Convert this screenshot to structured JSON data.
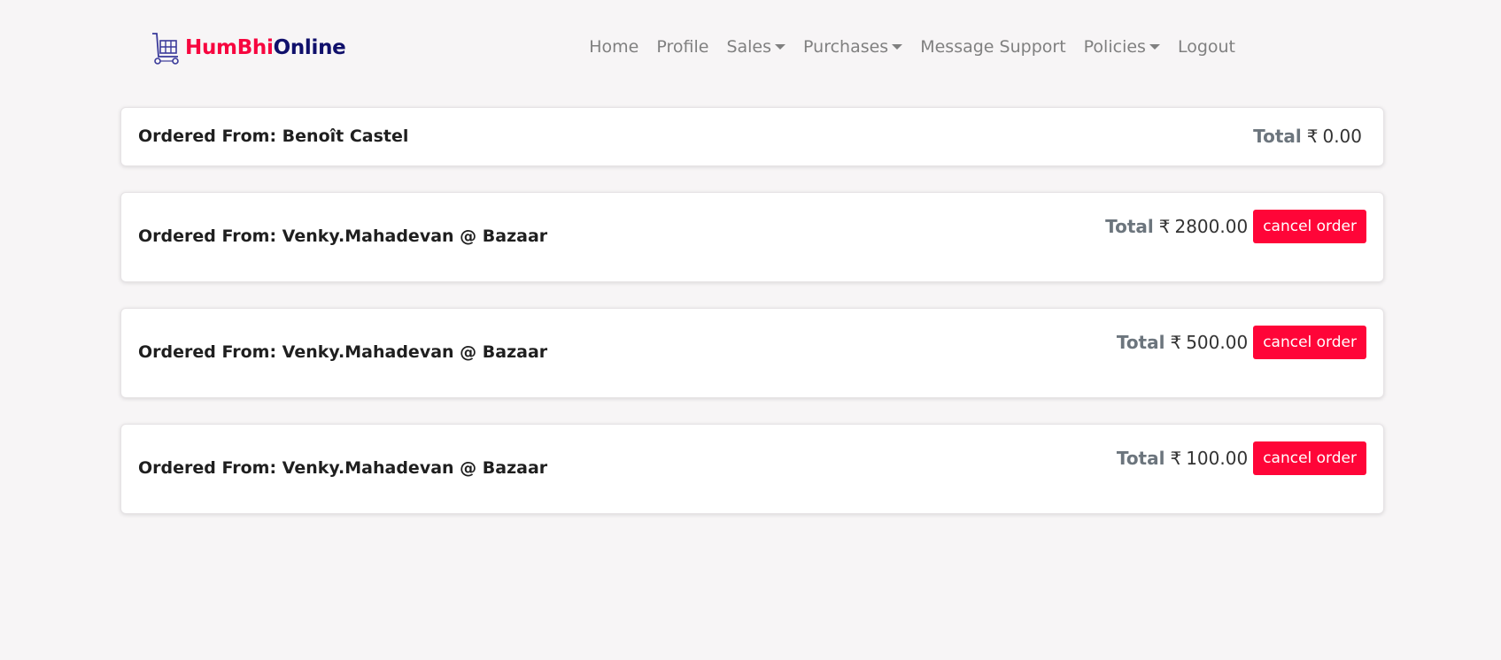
{
  "brand": {
    "part1": "HumBhi",
    "part2": "Online",
    "logo_icon": "cart-icon"
  },
  "nav": {
    "home": "Home",
    "profile": "Profile",
    "sales": "Sales",
    "purchases": "Purchases",
    "message_support": "Message Support",
    "policies": "Policies",
    "logout": "Logout"
  },
  "orders": [
    {
      "from_label": "Ordered From: Benoît Castel",
      "total_label": "Total",
      "currency": "₹",
      "amount": "0.00",
      "cancel_label": ""
    },
    {
      "from_label": "Ordered From: Venky.Mahadevan @ Bazaar",
      "total_label": "Total",
      "currency": "₹",
      "amount": "2800.00",
      "cancel_label": "cancel order"
    },
    {
      "from_label": "Ordered From: Venky.Mahadevan @ Bazaar",
      "total_label": "Total",
      "currency": "₹",
      "amount": "500.00",
      "cancel_label": "cancel order"
    },
    {
      "from_label": "Ordered From: Venky.Mahadevan @ Bazaar",
      "total_label": "Total",
      "currency": "₹",
      "amount": "100.00",
      "cancel_label": "cancel order"
    }
  ],
  "colors": {
    "brand_red": "#f7063f",
    "brand_navy": "#10106b",
    "cancel_button": "#ff0538",
    "background": "#f7f5f6"
  }
}
